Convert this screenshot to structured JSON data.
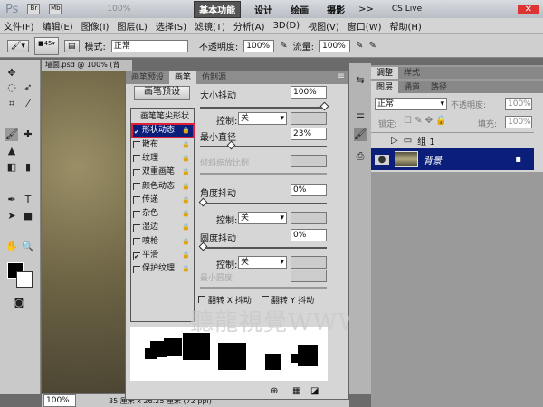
{
  "titlebar": {
    "logo": "Ps",
    "zoom": "100%",
    "workspaces": [
      "基本功能",
      "设计",
      "绘画",
      "摄影"
    ],
    "more": ">>",
    "cslive": "CS Live"
  },
  "menu": [
    "文件(F)",
    "编辑(E)",
    "图像(I)",
    "图层(L)",
    "选择(S)",
    "滤镜(T)",
    "分析(A)",
    "3D(D)",
    "视图(V)",
    "窗口(W)",
    "帮助(H)"
  ],
  "options": {
    "brush_size": "45",
    "mode_label": "模式:",
    "mode": "正常",
    "opacity_label": "不透明度:",
    "opacity": "100%",
    "flow_label": "流量:",
    "flow": "100%"
  },
  "document": {
    "tab": "墙面.psd @ 100% (背",
    "zoom": "100%",
    "info": "35 厘米 x 26.25 厘米 (72 ppi)"
  },
  "brush_panel": {
    "tabs": [
      "画笔预设",
      "画笔",
      "仿制源"
    ],
    "preset_button": "画笔预设",
    "items": [
      {
        "label": "画笔笔尖形状",
        "checked": null
      },
      {
        "label": "形状动态",
        "checked": true,
        "selected": true
      },
      {
        "label": "散布",
        "checked": false
      },
      {
        "label": "纹理",
        "checked": false
      },
      {
        "label": "双重画笔",
        "checked": false
      },
      {
        "label": "颜色动态",
        "checked": false
      },
      {
        "label": "传递",
        "checked": false
      },
      {
        "label": "杂色",
        "checked": false
      },
      {
        "label": "湿边",
        "checked": false
      },
      {
        "label": "喷枪",
        "checked": false
      },
      {
        "label": "平滑",
        "checked": true
      },
      {
        "label": "保护纹理",
        "checked": false
      }
    ],
    "size_jitter": {
      "label": "大小抖动",
      "value": "100%",
      "fraction": 1.0
    },
    "control1": {
      "label": "控制:",
      "value": "关"
    },
    "min_diameter": {
      "label": "最小直径",
      "value": "23%",
      "fraction": 0.23
    },
    "tilt_scale": {
      "label": "倾斜缩放比例"
    },
    "angle_jitter": {
      "label": "角度抖动",
      "value": "0%",
      "fraction": 0
    },
    "control2": {
      "label": "控制:",
      "value": "关"
    },
    "roundness_jitter": {
      "label": "圆度抖动",
      "value": "0%",
      "fraction": 0
    },
    "control3": {
      "label": "控制:",
      "value": "关"
    },
    "min_roundness": {
      "label": "最小圆度"
    },
    "flip_x": "翻转 X 抖动",
    "flip_y": "翻转 Y 抖动"
  },
  "layers_panel": {
    "tabs_top": [
      "调整",
      "样式"
    ],
    "tabs": [
      "图层",
      "通道",
      "路径"
    ],
    "blend": "正常",
    "opacity_label": "不透明度:",
    "opacity": "100%",
    "lock_label": "锁定:",
    "fill_label": "填充:",
    "fill": "100%",
    "layers": [
      {
        "name": "组 1"
      },
      {
        "name": "背景",
        "selected": true
      }
    ]
  },
  "watermark": "聽龍視覺WWW.TLVI.NET",
  "colors": {
    "selection": "#0b1f7a",
    "highlight": "#e0203a"
  }
}
